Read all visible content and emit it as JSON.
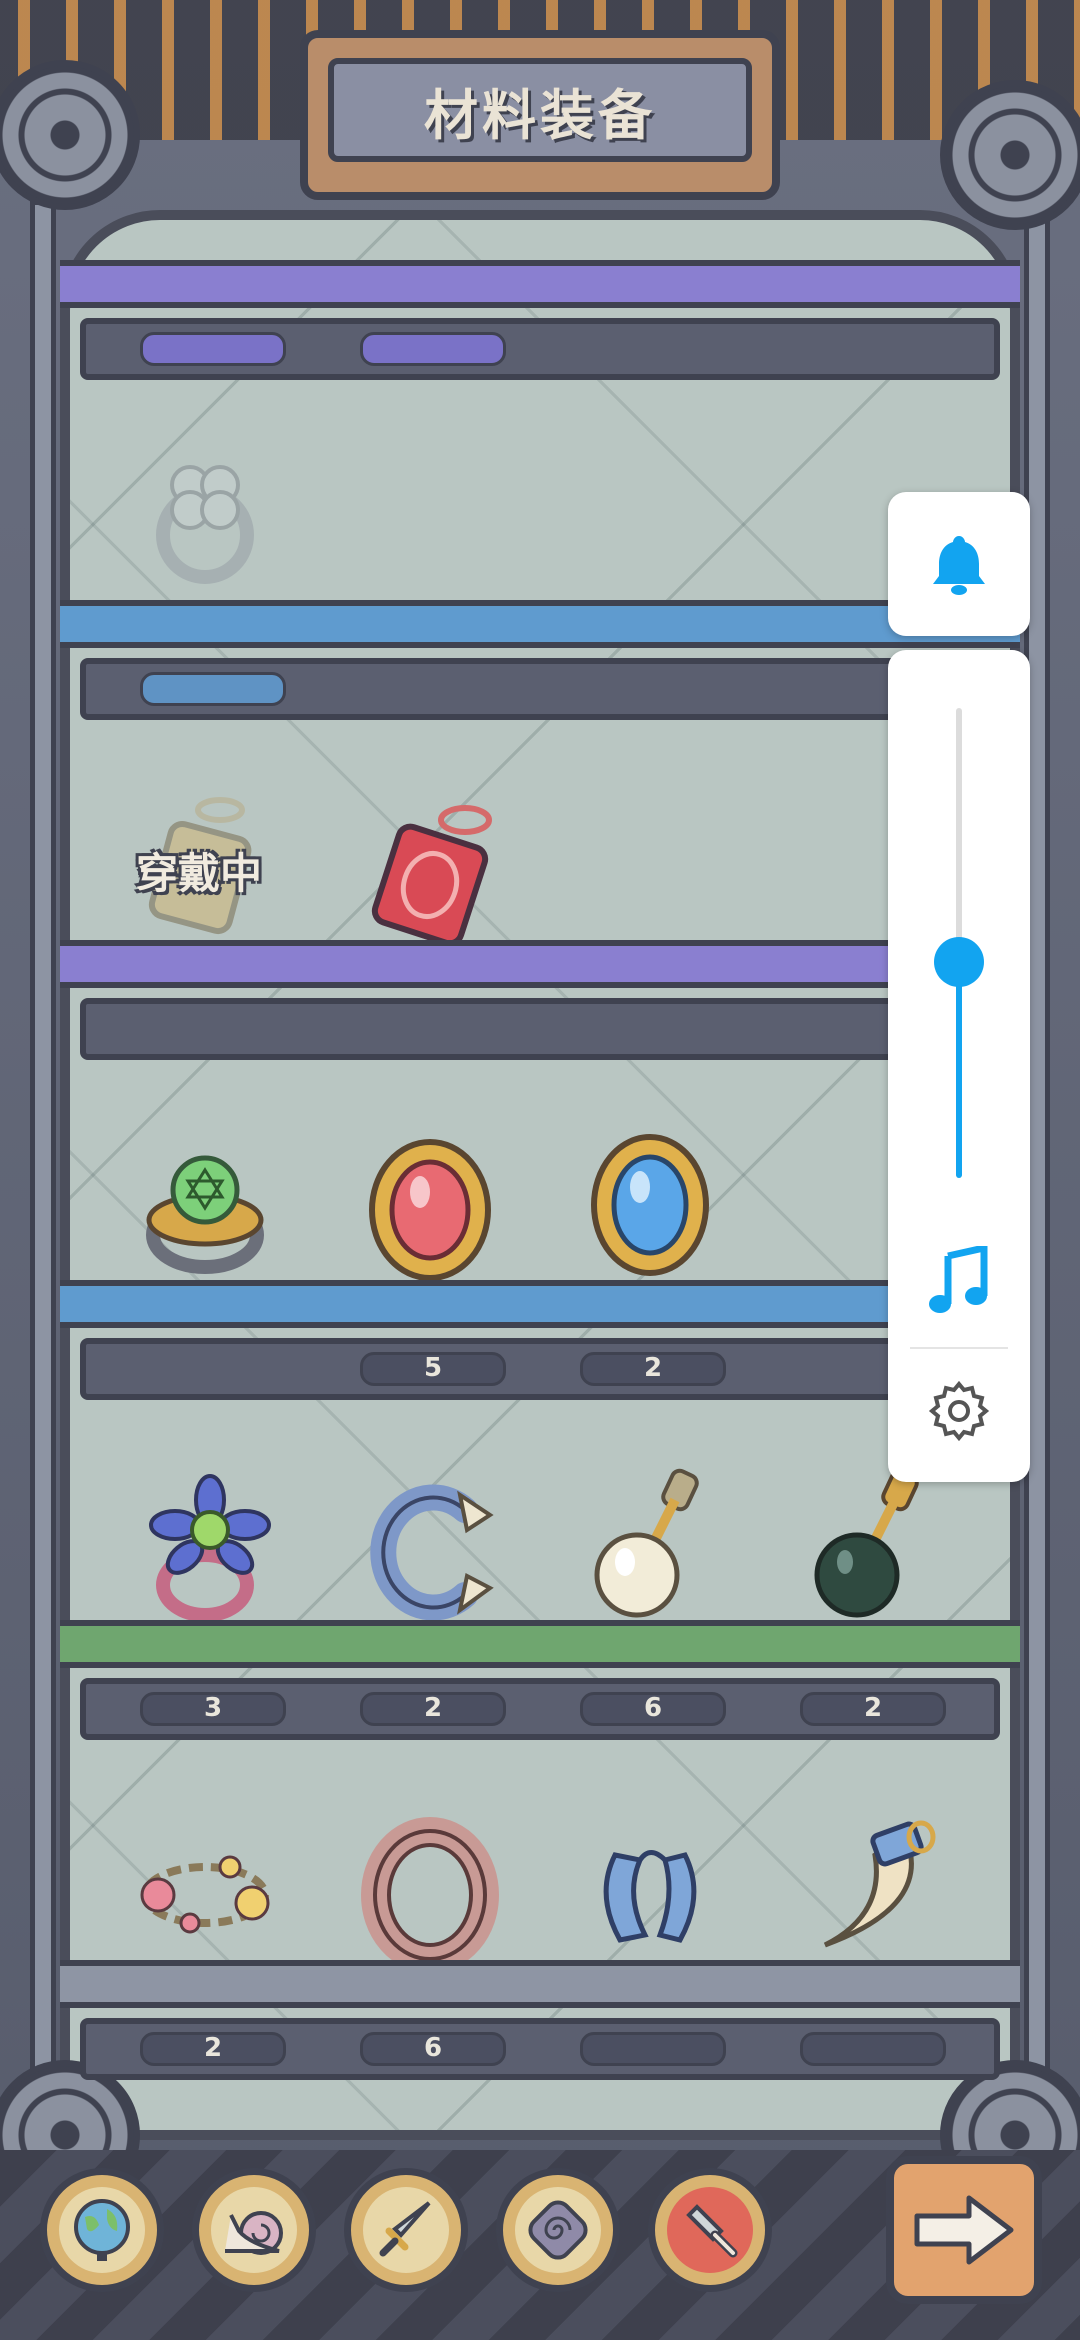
{
  "header": {
    "title": "材料装备"
  },
  "status": {
    "wearing_label": "穿戴中"
  },
  "shelves": [
    {
      "row": 1,
      "items": [
        {
          "icon": "silver-clover-ring-icon",
          "count": "",
          "faded": true
        }
      ]
    },
    {
      "row": 2,
      "items": [
        {
          "icon": "gold-amulet-pendant-icon",
          "count": "",
          "faded": true,
          "equipped": true
        },
        {
          "icon": "red-charm-pendant-icon",
          "count": ""
        }
      ]
    },
    {
      "row": 3,
      "items": [
        {
          "icon": "green-gem-ring-icon",
          "count": ""
        },
        {
          "icon": "ruby-brooch-icon",
          "count": "5"
        },
        {
          "icon": "sapphire-brooch-icon",
          "count": "2"
        }
      ]
    },
    {
      "row": 4,
      "items": [
        {
          "icon": "flower-ring-icon",
          "count": "3"
        },
        {
          "icon": "claw-bracelet-icon",
          "count": "2"
        },
        {
          "icon": "pearl-earring-icon",
          "count": "6"
        },
        {
          "icon": "black-pearl-earring-icon",
          "count": "2"
        }
      ]
    },
    {
      "row": 5,
      "items": [
        {
          "icon": "flower-bracelet-icon",
          "count": "2"
        },
        {
          "icon": "stone-bangle-icon",
          "count": "6"
        },
        {
          "icon": "blue-cuff-icon",
          "count": ""
        },
        {
          "icon": "horn-charm-icon",
          "count": ""
        }
      ]
    }
  ],
  "side_panel": {
    "bell": "bell-icon",
    "volume_level": 0.46,
    "music": "music-note-icon",
    "settings": "gear-icon"
  },
  "bottom_nav": [
    {
      "icon": "globe-icon",
      "active": false
    },
    {
      "icon": "snail-icon",
      "active": false
    },
    {
      "icon": "sword-icon",
      "active": false
    },
    {
      "icon": "spiral-shell-icon",
      "active": false
    },
    {
      "icon": "hammer-icon",
      "active": true
    }
  ],
  "next_button": {
    "icon": "arrow-right-icon"
  },
  "colors": {
    "accent": "#12a4f0",
    "shelf_purple": "#8a7fd0",
    "shelf_blue": "#5f9bcf",
    "shelf_green": "#6fa66f"
  }
}
